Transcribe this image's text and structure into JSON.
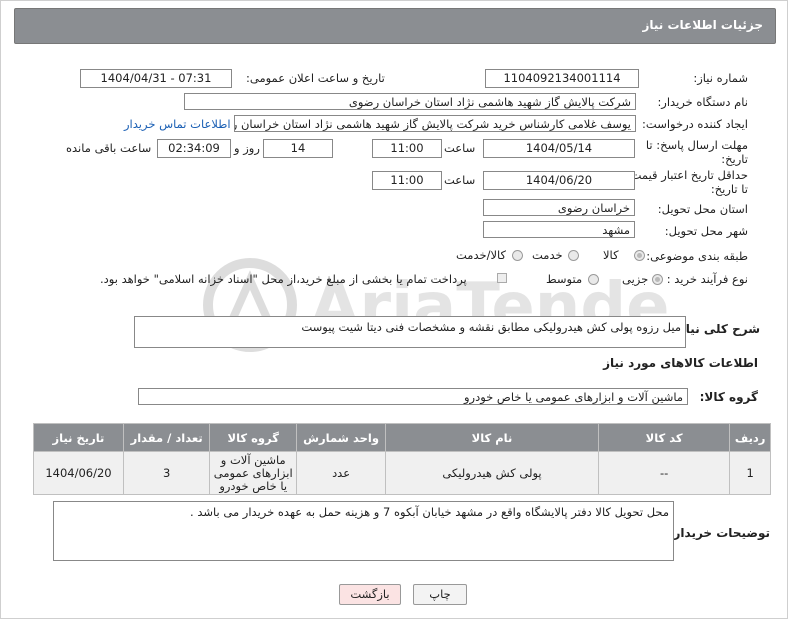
{
  "header": {
    "title": "جزئیات اطلاعات نیاز"
  },
  "fields": {
    "need_number_label": "شماره نیاز:",
    "need_number_value": "1104092134001114",
    "announce_label": "تاریخ و ساعت اعلان عمومی:",
    "announce_value": "1404/04/31 - 07:31",
    "buyer_label": "نام دستگاه خریدار:",
    "buyer_value": "شرکت پالایش گاز شهید هاشمی نژاد   استان خراسان رضوی",
    "creator_label": "ایجاد کننده درخواست:",
    "creator_value": "یوسف غلامی کارشناس خرید شرکت پالایش گاز شهید هاشمی نژاد   استان خراسان رضوی",
    "contact_link": "اطلاعات تماس خریدار",
    "deadline_label": "مهلت ارسال پاسخ: تا تاریخ:",
    "deadline_date": "1404/05/14",
    "time_label": "ساعت",
    "deadline_time": "11:00",
    "days_value": "14",
    "days_label": "روز و",
    "remaining_value": "02:34:09",
    "remaining_label": "ساعت باقی مانده",
    "validity_label": "حداقل تاریخ اعتبار قیمت: تا تاریخ:",
    "validity_date": "1404/06/20",
    "validity_time": "11:00",
    "province_label": "استان محل تحویل:",
    "province_value": "خراسان رضوی",
    "city_label": "شهر محل تحویل:",
    "city_value": "مشهد",
    "category_label": "طبقه بندی موضوعی:",
    "category_options": [
      "کالا",
      "خدمت",
      "کالا/خدمت"
    ],
    "category_selected": "کالا",
    "process_label": "نوع فرآیند خرید :",
    "process_options": [
      "جزیی",
      "متوسط"
    ],
    "process_selected": "جزیی",
    "payment_note": "پرداخت تمام یا بخشی از مبلغ خرید،از محل \"اسناد خزانه اسلامی\" خواهد بود.",
    "description_label": "شرح کلی نیاز:",
    "description_value": "میل رزوه پولی کش هیدرولیکی مطابق نقشه و مشخصات فنی دیتا شیت پیوست",
    "goods_info_title": "اطلاعات کالاهای مورد نیاز",
    "goods_group_label": "گروه کالا:",
    "goods_group_value": "ماشین آلات و ابزارهای عمومی یا خاص خودرو"
  },
  "table": {
    "headers": [
      "ردیف",
      "کد کالا",
      "نام کالا",
      "واحد شمارش",
      "گروه کالا",
      "تعداد / مقدار",
      "تاریخ نیاز"
    ],
    "rows": [
      [
        "1",
        "--",
        "پولی کش هیدرولیکی",
        "عدد",
        "ماشین آلات و ابزارهای عمومی یا خاص خودرو",
        "3",
        "1404/06/20"
      ]
    ]
  },
  "buyer_notes": {
    "label": "توضیحات خریدار:",
    "value": "محل تحویل کالا دفتر پالایشگاه واقع در مشهد خیابان آبکوه 7 و هزینه حمل به عهده خریدار می باشد ."
  },
  "buttons": {
    "print": "چاپ",
    "back": "بازگشت"
  },
  "watermark": {
    "text": "AriaTender.neT"
  },
  "colors": {
    "header_bg": "#8b8e92",
    "link": "#1a5fb4",
    "back_button_bg": "#fbe3e3",
    "print_button_bg": "#f3f3f3"
  }
}
